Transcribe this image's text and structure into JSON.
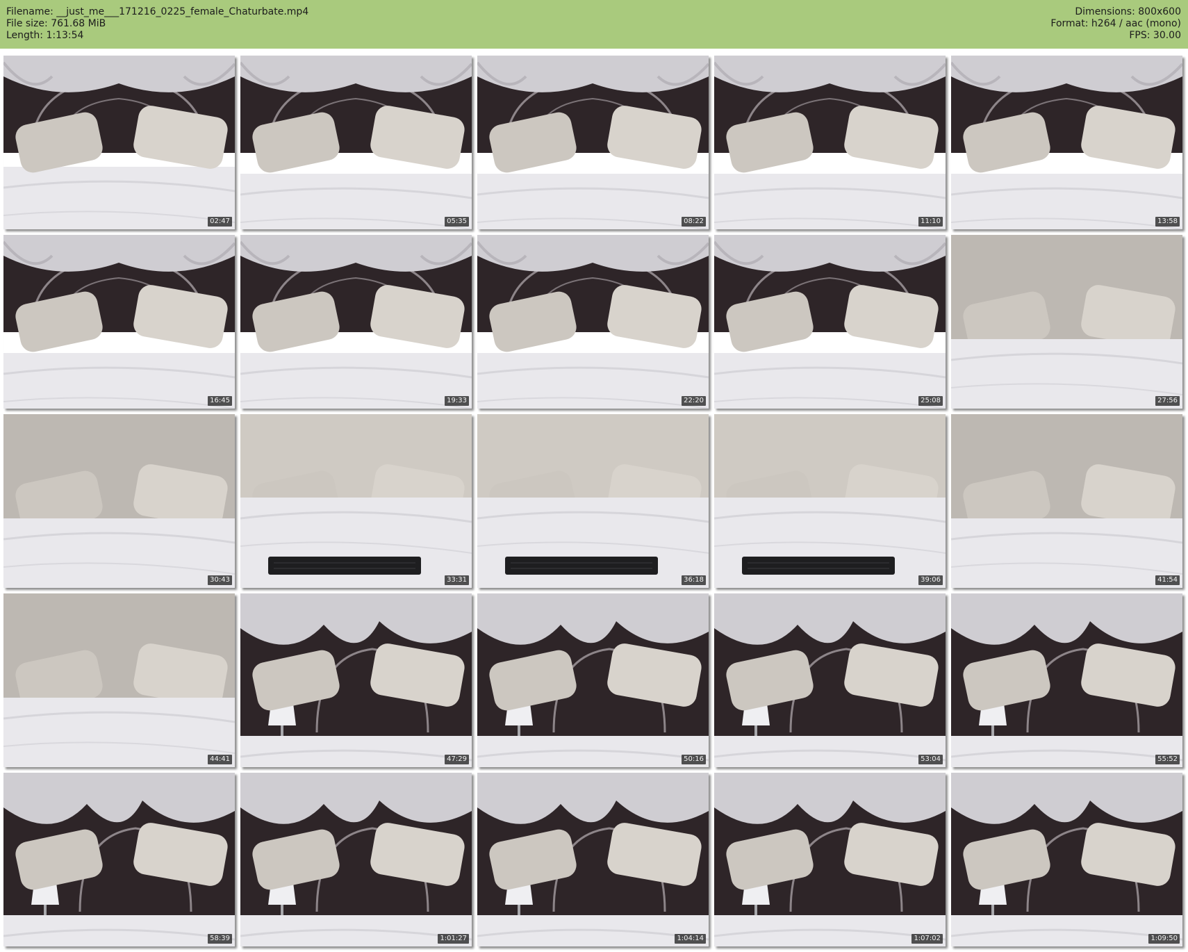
{
  "header": {
    "filename_line": "Filename: __just_me___171216_0225_female_Chaturbate.mp4",
    "filesize_line": "File size: 761.68 MiB",
    "length_line": "Length: 1:13:54",
    "dimensions_line": "Dimensions: 800x600",
    "format_line": "Format: h264 / aac (mono)",
    "fps_line": "FPS: 30.00"
  },
  "colors": {
    "header_bg": "#a9ca7d",
    "page_bg": "#ffffff",
    "headboard": "#2e2528",
    "bedsheet": "#e9e8ec",
    "curtain": "#cfcdd2"
  },
  "thumbnails": [
    {
      "time": "02:47",
      "scene": "wide"
    },
    {
      "time": "05:35",
      "scene": "close"
    },
    {
      "time": "08:22",
      "scene": "close"
    },
    {
      "time": "11:10",
      "scene": "close"
    },
    {
      "time": "13:58",
      "scene": "close"
    },
    {
      "time": "16:45",
      "scene": "close"
    },
    {
      "time": "19:33",
      "scene": "close"
    },
    {
      "time": "22:20",
      "scene": "close"
    },
    {
      "time": "25:08",
      "scene": "close"
    },
    {
      "time": "27:56",
      "scene": "pillows"
    },
    {
      "time": "30:43",
      "scene": "pillows"
    },
    {
      "time": "33:31",
      "scene": "keyboard"
    },
    {
      "time": "36:18",
      "scene": "keyboard"
    },
    {
      "time": "39:06",
      "scene": "keyboard"
    },
    {
      "time": "41:54",
      "scene": "pillows"
    },
    {
      "time": "44:41",
      "scene": "pillows"
    },
    {
      "time": "47:29",
      "scene": "room"
    },
    {
      "time": "50:16",
      "scene": "room"
    },
    {
      "time": "53:04",
      "scene": "room"
    },
    {
      "time": "55:52",
      "scene": "room"
    },
    {
      "time": "58:39",
      "scene": "room"
    },
    {
      "time": "1:01:27",
      "scene": "room"
    },
    {
      "time": "1:04:14",
      "scene": "room"
    },
    {
      "time": "1:07:02",
      "scene": "room"
    },
    {
      "time": "1:09:50",
      "scene": "room"
    }
  ]
}
